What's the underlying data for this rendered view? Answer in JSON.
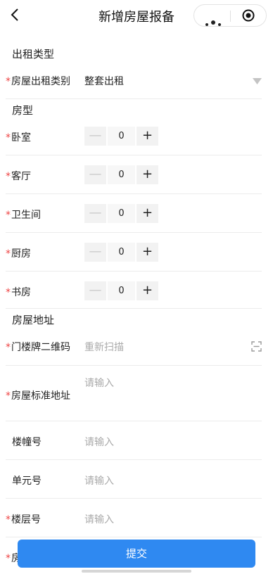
{
  "header": {
    "title": "新增房屋报备"
  },
  "sections": {
    "rent_type": "出租类型",
    "house_type": "房型",
    "address": "房屋地址"
  },
  "rent_category": {
    "label": "房屋出租类别",
    "value": "整套出租"
  },
  "rooms": [
    {
      "label": "卧室",
      "value": "0"
    },
    {
      "label": "客厅",
      "value": "0"
    },
    {
      "label": "卫生间",
      "value": "0"
    },
    {
      "label": "厨房",
      "value": "0"
    },
    {
      "label": "书房",
      "value": "0"
    }
  ],
  "address_fields": {
    "qr": {
      "label": "门楼牌二维码",
      "placeholder": "重新扫描"
    },
    "standard": {
      "label": "房屋标准地址",
      "placeholder": "请输入"
    },
    "building": {
      "label": "楼幢号",
      "placeholder": "请输入"
    },
    "unit": {
      "label": "单元号",
      "placeholder": "请输入"
    },
    "floor": {
      "label": "楼层号",
      "placeholder": "请输入"
    },
    "partial": {
      "label": "房"
    }
  },
  "stepper_symbols": {
    "minus": "—",
    "plus": "+"
  },
  "required_mark": "*",
  "submit_label": "提交",
  "colors": {
    "accent": "#2f89f1",
    "required": "#ee4444",
    "placeholder": "#aaaaaa"
  }
}
